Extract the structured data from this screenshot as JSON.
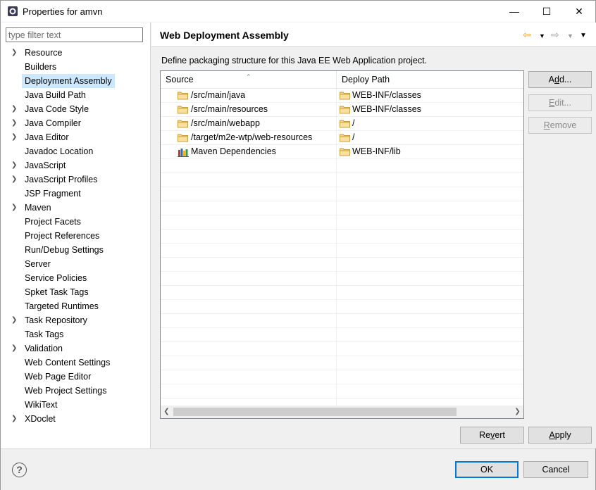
{
  "window": {
    "title": "Properties for amvn",
    "controls": {
      "minimize": "—",
      "maximize": "☐",
      "close": "✕"
    }
  },
  "filter": {
    "placeholder": "type filter text",
    "value": ""
  },
  "tree": {
    "items": [
      {
        "label": "Resource",
        "expandable": true
      },
      {
        "label": "Builders",
        "expandable": false
      },
      {
        "label": "Deployment Assembly",
        "expandable": false,
        "selected": true
      },
      {
        "label": "Java Build Path",
        "expandable": false
      },
      {
        "label": "Java Code Style",
        "expandable": true
      },
      {
        "label": "Java Compiler",
        "expandable": true
      },
      {
        "label": "Java Editor",
        "expandable": true
      },
      {
        "label": "Javadoc Location",
        "expandable": false
      },
      {
        "label": "JavaScript",
        "expandable": true
      },
      {
        "label": "JavaScript Profiles",
        "expandable": true
      },
      {
        "label": "JSP Fragment",
        "expandable": false
      },
      {
        "label": "Maven",
        "expandable": true
      },
      {
        "label": "Project Facets",
        "expandable": false
      },
      {
        "label": "Project References",
        "expandable": false
      },
      {
        "label": "Run/Debug Settings",
        "expandable": false
      },
      {
        "label": "Server",
        "expandable": false
      },
      {
        "label": "Service Policies",
        "expandable": false
      },
      {
        "label": "Spket Task Tags",
        "expandable": false
      },
      {
        "label": "Targeted Runtimes",
        "expandable": false
      },
      {
        "label": "Task Repository",
        "expandable": true
      },
      {
        "label": "Task Tags",
        "expandable": false
      },
      {
        "label": "Validation",
        "expandable": true
      },
      {
        "label": "Web Content Settings",
        "expandable": false
      },
      {
        "label": "Web Page Editor",
        "expandable": false
      },
      {
        "label": "Web Project Settings",
        "expandable": false
      },
      {
        "label": "WikiText",
        "expandable": false
      },
      {
        "label": "XDoclet",
        "expandable": true
      }
    ]
  },
  "page": {
    "title": "Web Deployment Assembly",
    "description": "Define packaging structure for this Java EE Web Application project."
  },
  "table": {
    "columns": {
      "source": "Source",
      "deploy": "Deploy Path"
    },
    "rows": [
      {
        "source": "/src/main/java",
        "source_icon": "folder-icon",
        "deploy": "WEB-INF/classes"
      },
      {
        "source": "/src/main/resources",
        "source_icon": "folder-icon",
        "deploy": "WEB-INF/classes"
      },
      {
        "source": "/src/main/webapp",
        "source_icon": "folder-icon",
        "deploy": "/"
      },
      {
        "source": "/target/m2e-wtp/web-resources",
        "source_icon": "folder-icon",
        "deploy": "/"
      },
      {
        "source": "Maven Dependencies",
        "source_icon": "library-icon",
        "deploy": "WEB-INF/lib"
      }
    ],
    "empty_rows": 18
  },
  "buttons": {
    "add": "Add...",
    "edit": "Edit...",
    "remove": "Remove",
    "revert": "Revert",
    "apply": "Apply",
    "ok": "OK",
    "cancel": "Cancel"
  },
  "colors": {
    "selection": "#cce8ff",
    "default_button_border": "#0078d7",
    "folder": "#e8c060"
  }
}
